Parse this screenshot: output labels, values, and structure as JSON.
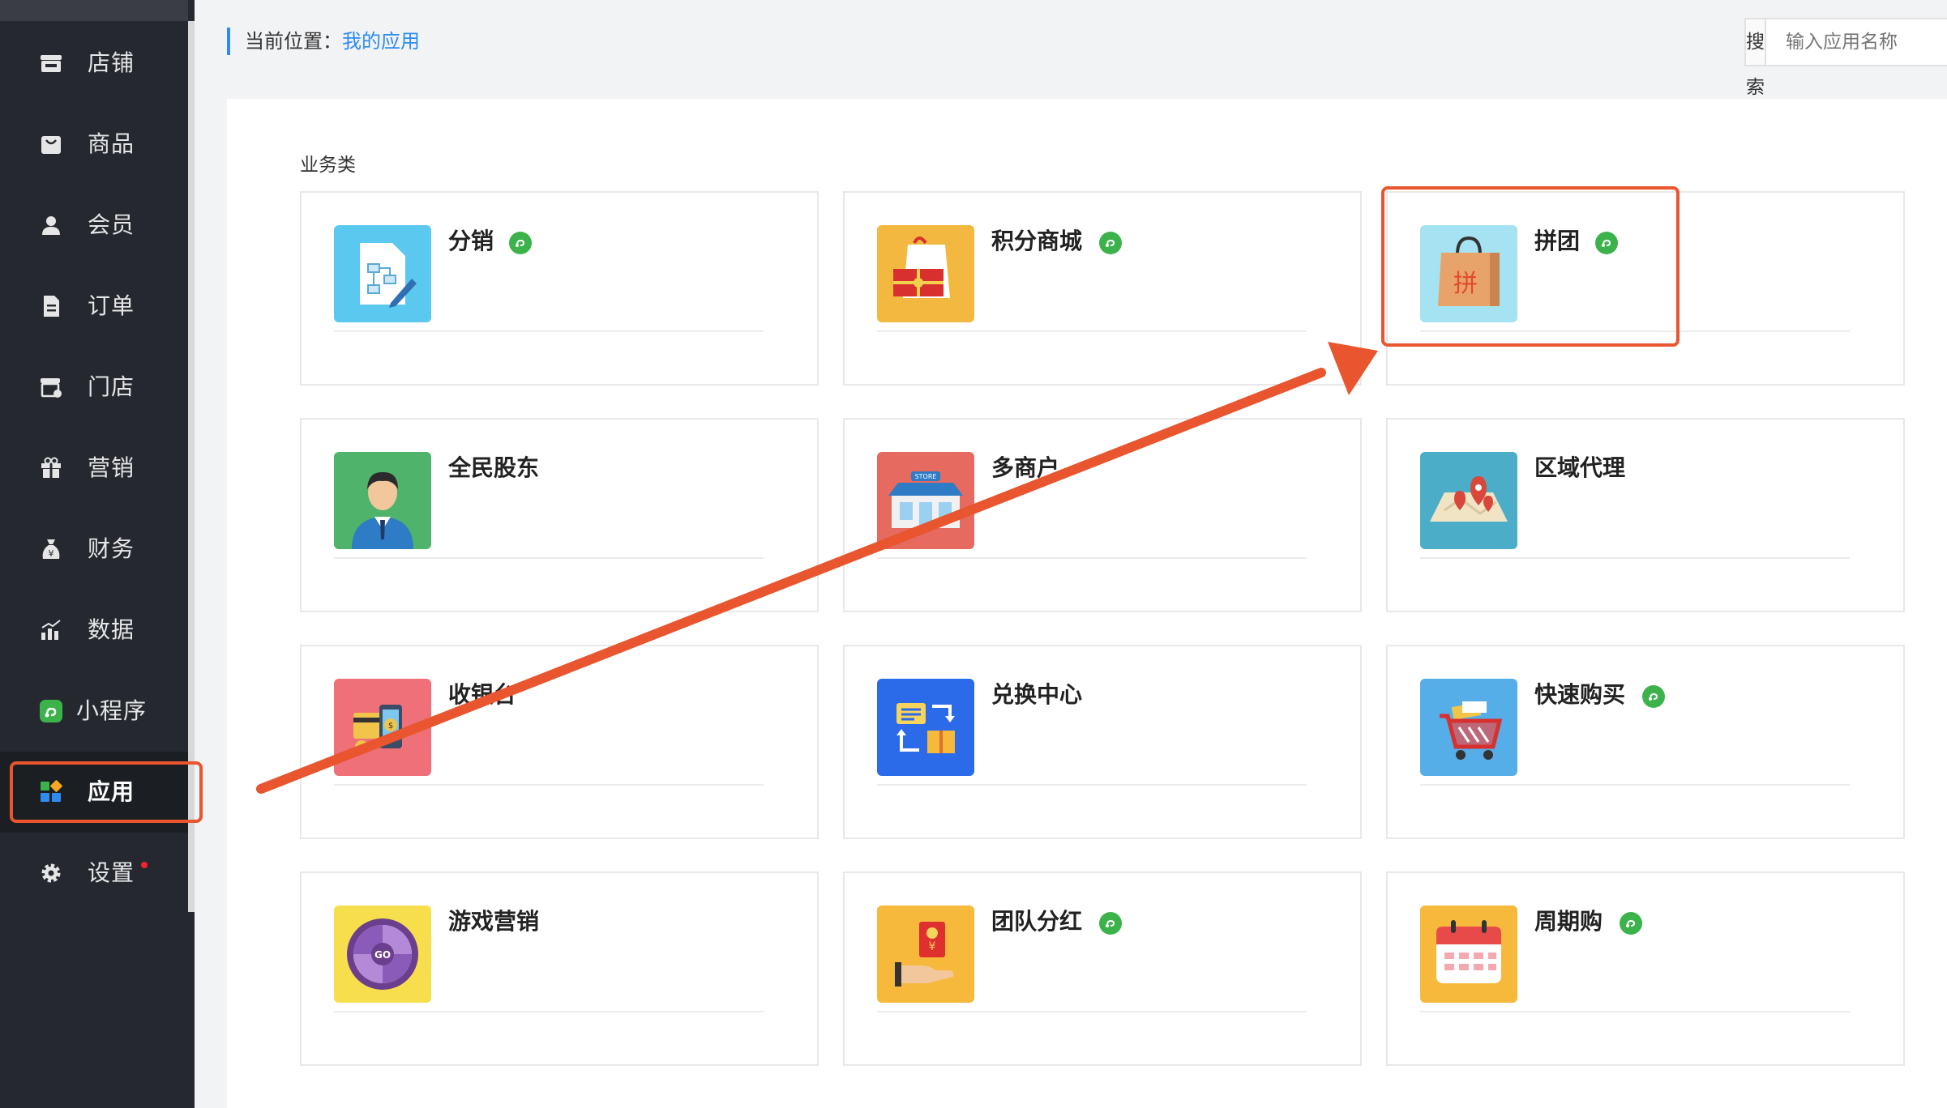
{
  "sidebar": {
    "items": [
      {
        "label": "店铺",
        "icon": "store-icon"
      },
      {
        "label": "商品",
        "icon": "bag-icon"
      },
      {
        "label": "会员",
        "icon": "user-icon"
      },
      {
        "label": "订单",
        "icon": "document-icon"
      },
      {
        "label": "门店",
        "icon": "shop-icon"
      },
      {
        "label": "营销",
        "icon": "gift-icon"
      },
      {
        "label": "财务",
        "icon": "money-bag-icon"
      },
      {
        "label": "数据",
        "icon": "bar-chart-icon"
      },
      {
        "label": "小程序",
        "icon": "mini-program-icon"
      },
      {
        "label": "应用",
        "icon": "apps-grid-icon",
        "active": true
      },
      {
        "label": "设置",
        "icon": "gear-icon",
        "badge": "red-dot"
      }
    ]
  },
  "breadcrumb": {
    "prefix": "当前位置：",
    "current": "我的应用"
  },
  "search": {
    "button_label": "搜索",
    "placeholder": "输入应用名称"
  },
  "section": {
    "title": "业务类"
  },
  "apps": [
    {
      "name": "分销",
      "icon": "distribution-icon",
      "icon_bg": "#5bc8f0",
      "mini_program": true
    },
    {
      "name": "积分商城",
      "icon": "points-mall-icon",
      "icon_bg": "#f3b83f",
      "mini_program": true
    },
    {
      "name": "拼团",
      "icon": "group-buy-icon",
      "icon_bg": "#a6e3f2",
      "mini_program": true
    },
    {
      "name": "全民股东",
      "icon": "shareholder-icon",
      "icon_bg": "#4fb36b",
      "mini_program": false
    },
    {
      "name": "多商户",
      "icon": "multi-merchant-icon",
      "icon_bg": "#e66a5f",
      "mini_program": false
    },
    {
      "name": "区域代理",
      "icon": "region-agent-icon",
      "icon_bg": "#4cadc9",
      "mini_program": false
    },
    {
      "name": "收银台",
      "icon": "cashier-icon",
      "icon_bg": "#ef7078",
      "mini_program": false
    },
    {
      "name": "兑换中心",
      "icon": "exchange-center-icon",
      "icon_bg": "#2b6ae8",
      "mini_program": false
    },
    {
      "name": "快速购买",
      "icon": "quick-buy-icon",
      "icon_bg": "#55aee8",
      "mini_program": true
    },
    {
      "name": "游戏营销",
      "icon": "game-marketing-icon",
      "icon_bg": "#f6de4c",
      "mini_program": false
    },
    {
      "name": "团队分红",
      "icon": "team-bonus-icon",
      "icon_bg": "#f6b93b",
      "mini_program": true
    },
    {
      "name": "周期购",
      "icon": "periodic-buy-icon",
      "icon_bg": "#f6b93b",
      "mini_program": true
    }
  ],
  "annotation": {
    "highlight_color": "#e8552e"
  }
}
